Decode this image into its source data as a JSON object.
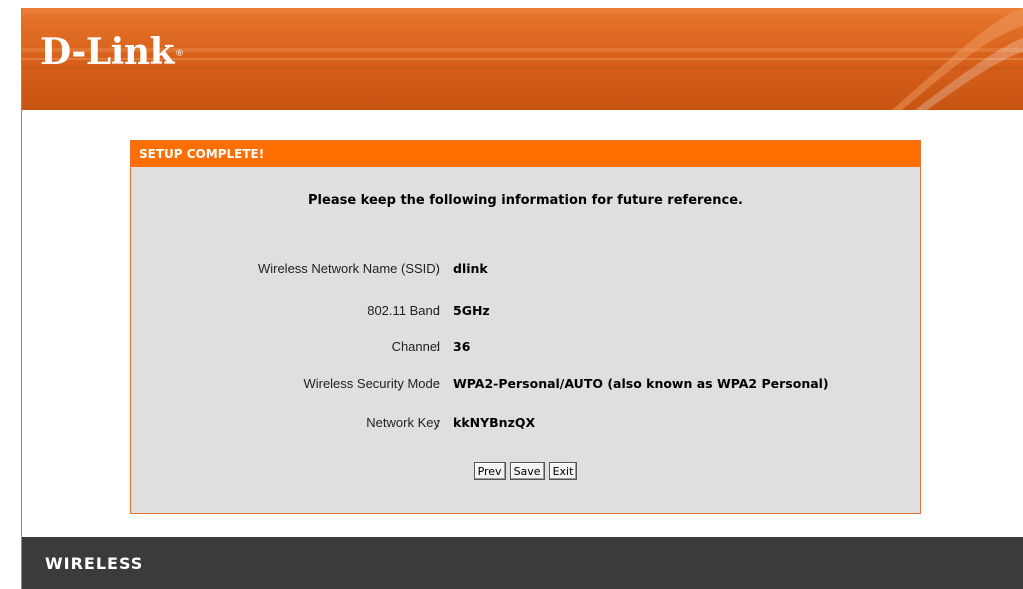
{
  "header": {
    "brand": "D-Link",
    "brand_mark": "®"
  },
  "panel": {
    "title": "SETUP COMPLETE!",
    "intro": "Please keep the following information for future reference.",
    "rows": [
      {
        "label": "Wireless Network Name (SSID)",
        "value": "dlink"
      },
      {
        "label": "802.11 Band",
        "value": "5GHz"
      },
      {
        "label": "Channel",
        "value": "36"
      },
      {
        "label": "Wireless Security Mode",
        "value": "WPA2-Personal/AUTO (also known as WPA2 Personal)"
      },
      {
        "label": "Network Key",
        "value": "kkNYBnzQX"
      }
    ],
    "colon": ":"
  },
  "buttons": {
    "prev": "Prev",
    "save": "Save",
    "exit": "Exit"
  },
  "footer": {
    "label": "WIRELESS"
  },
  "colors": {
    "header_orange": "#d9621c",
    "title_orange": "#ff6f00",
    "panel_gray": "#dfdfdf",
    "footer_dark": "#3b3b3b"
  }
}
